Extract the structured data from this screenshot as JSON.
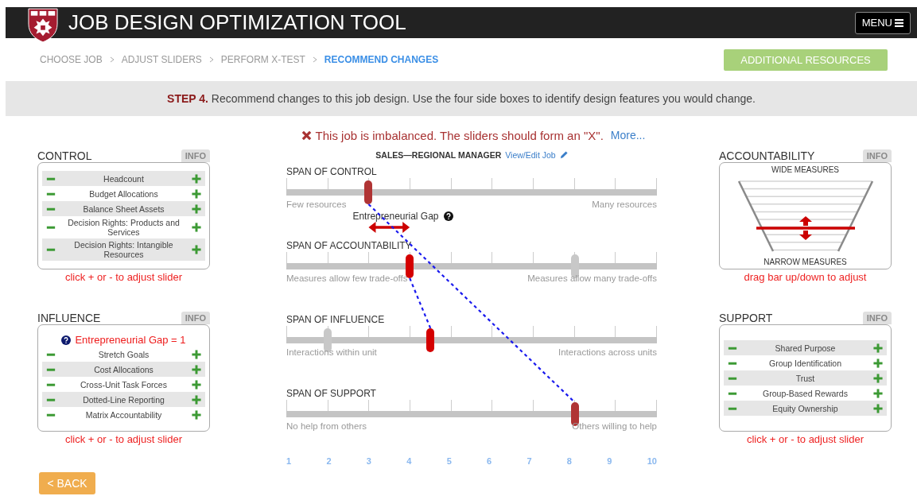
{
  "header": {
    "title": "JOB DESIGN OPTIMIZATION TOOL",
    "menu_button": "MENU"
  },
  "breadcrumb": [
    {
      "label": "CHOOSE JOB",
      "selected": false
    },
    {
      "label": "ADJUST SLIDERS",
      "selected": false
    },
    {
      "label": "PERFORM X-TEST",
      "selected": false
    },
    {
      "label": "RECOMMEND CHANGES",
      "selected": true
    }
  ],
  "resources_button": "ADDITIONAL RESOURCES",
  "instruction": {
    "step": "STEP 4.",
    "text": "Recommend changes to this job design. Use the four side boxes to identify design features you would change."
  },
  "alert": {
    "text": "This job is imbalanced. The sliders should form an \"X\".",
    "link": "More..."
  },
  "job": {
    "title": "SALES—REGIONAL MANAGER",
    "link": "View/Edit Job"
  },
  "left_panels": [
    {
      "kind": "buttons",
      "title": "CONTROL",
      "info": "INFO",
      "items": [
        "Headcount",
        "Budget Allocations",
        "Balance Sheet Assets",
        "Decision Rights: Products and Services",
        "Decision Rights: Intangible Resources"
      ],
      "hint": "click + or - to adjust slider"
    },
    {
      "kind": "buttons",
      "title": "INFLUENCE",
      "info": "INFO",
      "gap_note": "Entrepreneurial Gap = 1",
      "items": [
        "Stretch Goals",
        "Cost Allocations",
        "Cross-Unit Task Forces",
        "Dotted-Line Reporting",
        "Matrix Accountability"
      ],
      "hint": "click + or - to adjust slider"
    }
  ],
  "right_panels": [
    {
      "kind": "funnel",
      "title": "ACCOUNTABILITY",
      "info": "INFO",
      "top_label": "WIDE MEASURES",
      "bottom_label": "NARROW MEASURES",
      "hint": "drag bar up/down to adjust"
    },
    {
      "kind": "buttons",
      "title": "SUPPORT",
      "info": "INFO",
      "items": [
        "Shared Purpose",
        "Group Identification",
        "Trust",
        "Group-Based Rewards",
        "Equity Ownership"
      ],
      "hint": "click + or - to adjust slider"
    }
  ],
  "sliders": [
    {
      "title": "SPAN OF CONTROL",
      "left_label": "Few resources",
      "right_label": "Many resources",
      "level": 0.222,
      "color": "#b03434"
    },
    {
      "title": "SPAN OF ACCOUNTABILITY",
      "left_label": "Measures allow few trade-offs",
      "right_label": "Measures allow many trade-offs",
      "level": 0.333,
      "previous": {
        "level": 0.778
      },
      "color": "#d40000"
    },
    {
      "title": "SPAN OF INFLUENCE",
      "left_label": "Interactions within unit",
      "right_label": "Interactions across units",
      "level": 0.389,
      "previous": {
        "level": 0.111
      },
      "color": "#d40000"
    },
    {
      "title": "SPAN OF SUPPORT",
      "left_label": "No help from others",
      "right_label": "Others willing to help",
      "level": 0.778,
      "color": "#b03434"
    }
  ],
  "gap": {
    "label": "Entrepreneurial Gap"
  },
  "scale": [
    "1",
    "2",
    "3",
    "4",
    "5",
    "6",
    "7",
    "8",
    "9",
    "10"
  ],
  "back_button": "< BACK"
}
